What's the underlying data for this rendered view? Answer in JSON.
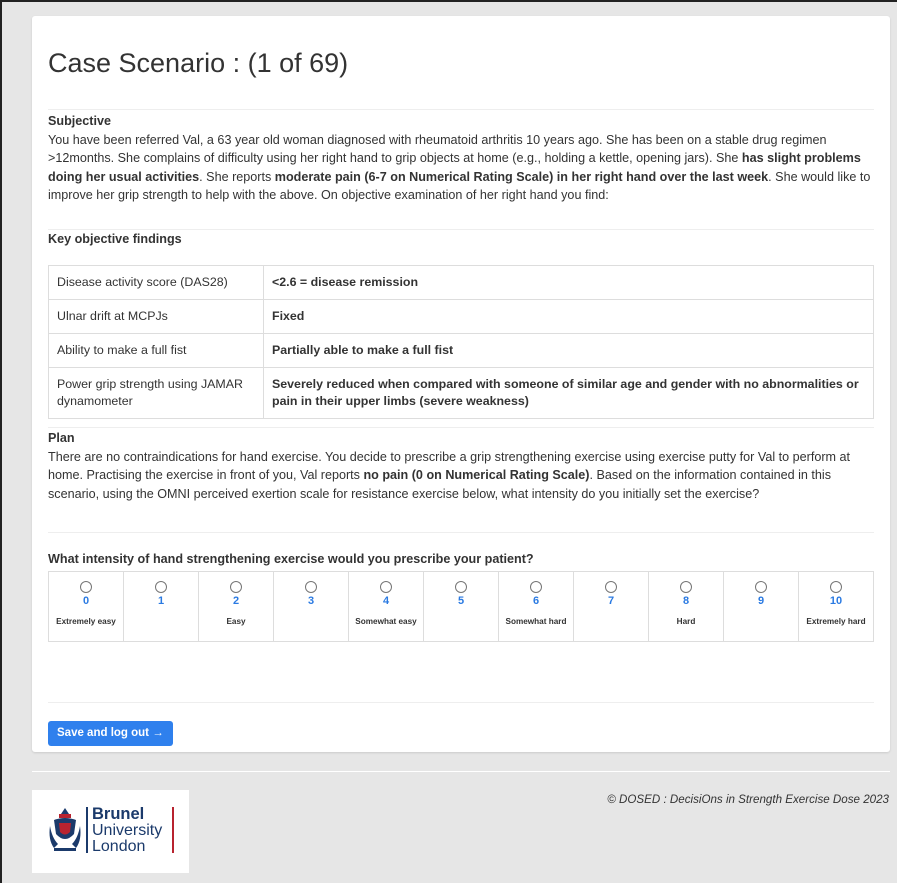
{
  "page": {
    "title": "Case Scenario : (1 of 69)"
  },
  "subjective": {
    "heading": "Subjective",
    "text_1": "You have been referred Val, a 63 year old woman diagnosed with rheumatoid arthritis 10 years ago. She has been on a stable drug regimen >12months. She complains of difficulty using her right hand to grip objects at home (e.g., holding a kettle, opening jars). She ",
    "bold_1": "has slight problems doing her usual activities",
    "text_2": ". She reports ",
    "bold_2": "moderate pain (6-7 on Numerical Rating Scale) in her right hand over the last week",
    "text_3": ". She would like to improve her grip strength to help with the above. On objective examination of her right hand you find:"
  },
  "findings": {
    "heading": "Key objective findings",
    "rows": [
      {
        "key": "Disease activity score (DAS28)",
        "value": "<2.6 = disease remission"
      },
      {
        "key": "Ulnar drift at MCPJs",
        "value": "Fixed"
      },
      {
        "key": "Ability to make a full fist",
        "value": "Partially able to make a full fist"
      },
      {
        "key": "Power grip strength using JAMAR dynamometer",
        "value": "Severely reduced when compared with someone of similar age and gender with no abnormalities or pain in their upper limbs (severe weakness)"
      }
    ]
  },
  "plan": {
    "heading": "Plan",
    "text_1": "There are no contraindications for hand exercise. You decide to prescribe a grip strengthening exercise using exercise putty for Val to perform at home. Practising the exercise in front of you, Val reports ",
    "bold_1": "no pain (0 on Numerical Rating Scale)",
    "text_2": ". Based on the information contained in this scenario, using the OMNI perceived exertion scale for resistance exercise below, what intensity do you initially set the exercise?"
  },
  "question": {
    "label": "What intensity of hand strengthening exercise would you prescribe your patient?",
    "options": [
      {
        "value": "0",
        "label": "Extremely easy"
      },
      {
        "value": "1",
        "label": ""
      },
      {
        "value": "2",
        "label": "Easy"
      },
      {
        "value": "3",
        "label": ""
      },
      {
        "value": "4",
        "label": "Somewhat easy"
      },
      {
        "value": "5",
        "label": ""
      },
      {
        "value": "6",
        "label": "Somewhat hard"
      },
      {
        "value": "7",
        "label": ""
      },
      {
        "value": "8",
        "label": "Hard"
      },
      {
        "value": "9",
        "label": ""
      },
      {
        "value": "10",
        "label": "Extremely hard"
      }
    ]
  },
  "actions": {
    "save_label": "Save and log out →"
  },
  "footer": {
    "copyright": "© DOSED : DecisiOns in Strength Exercise Dose 2023",
    "logo_line1": "Brunel",
    "logo_line2": "University",
    "logo_line3": "London"
  },
  "colors": {
    "accent": "#2f80ed",
    "link_number": "#2a7ae2",
    "logo_blue": "#1b3a6b",
    "logo_red": "#b8232f"
  }
}
